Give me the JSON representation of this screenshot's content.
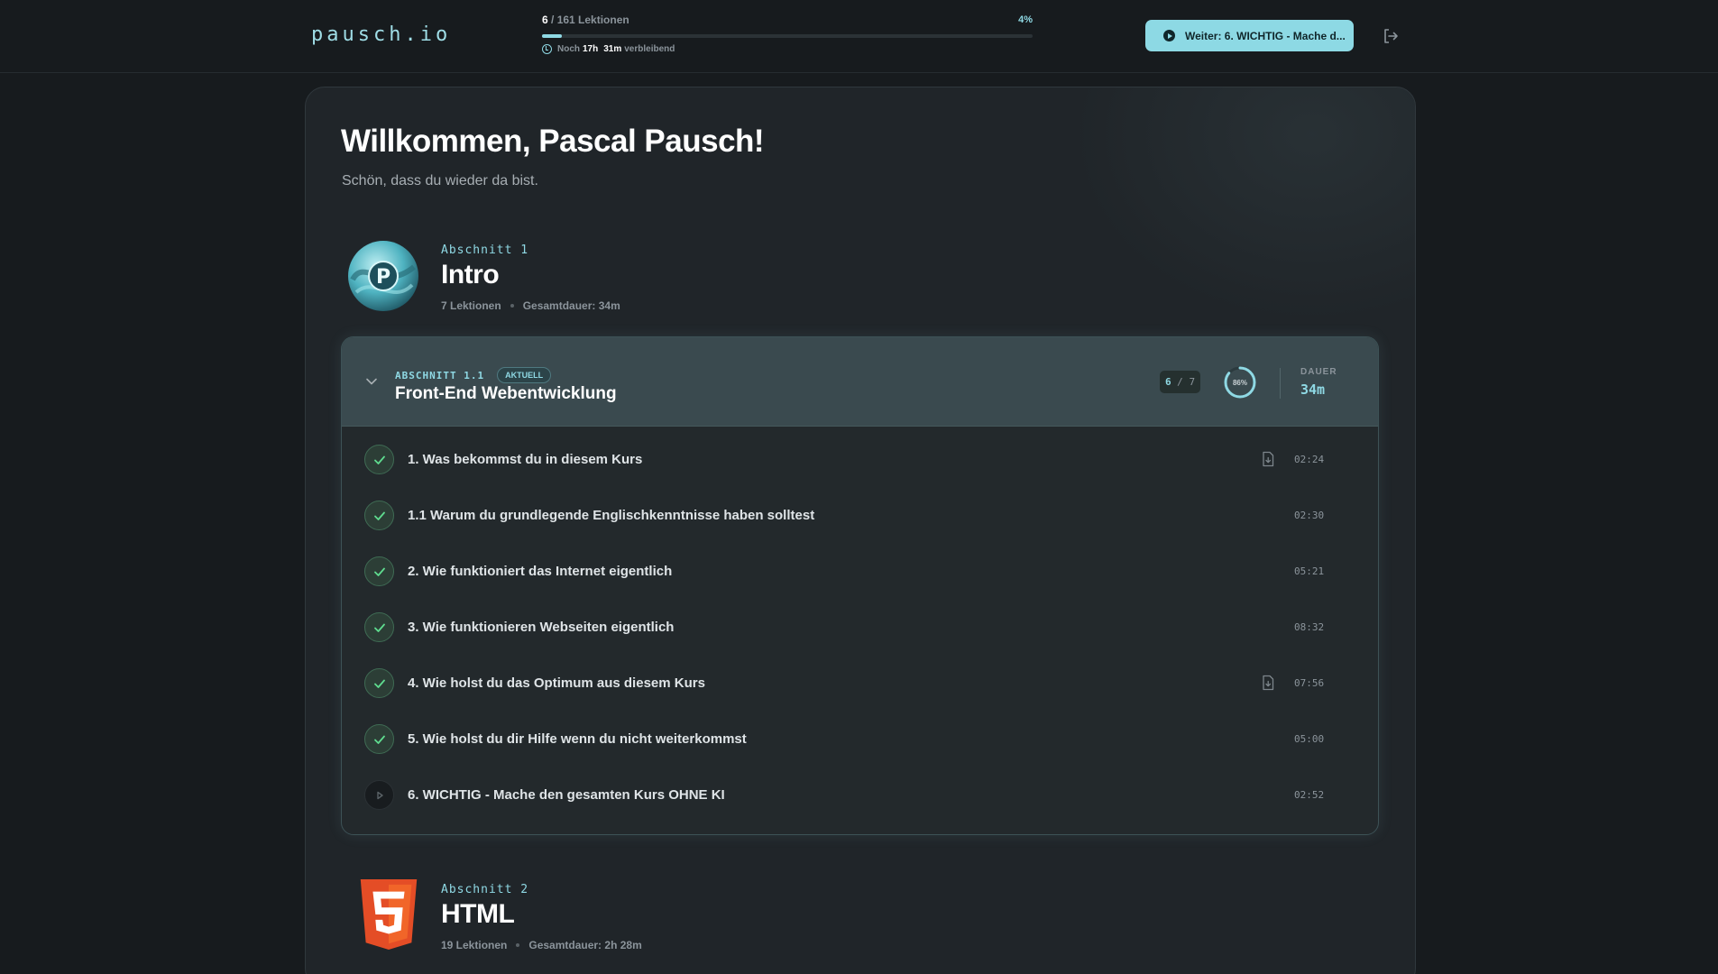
{
  "header": {
    "logo": "pausch.io",
    "progress": {
      "done": "6",
      "total_label": " / 161 Lektionen",
      "percent_label": "4%",
      "fraction": 0.04
    },
    "remaining": {
      "prefix": "Noch",
      "hours": "17h",
      "minutes": "31m",
      "suffix": "verbleibend"
    },
    "continue_label": "Weiter: 6. WICHTIG - Mache d..."
  },
  "welcome": {
    "title": "Willkommen, Pascal Pausch!",
    "subtitle": "Schön, dass du wieder da bist."
  },
  "sections": [
    {
      "kicker": "Abschnitt 1",
      "title": "Intro",
      "lessons_count": "7 Lektionen",
      "total_duration": "Gesamtdauer: 34m",
      "logo_letter": "P",
      "subsection": {
        "kicker": "ABSCHNITT 1.1",
        "badge": "AKTUELL",
        "title": "Front-End Webentwicklung",
        "done": "6",
        "total": "7",
        "percent_label": "86%",
        "percent": 0.86,
        "duration_label": "DAUER",
        "duration": "34m",
        "lessons": [
          {
            "label": "1. Was bekommst du in diesem Kurs",
            "time": "02:24",
            "done": true,
            "has_doc": true
          },
          {
            "label": "1.1 Warum du grundlegende Englischkenntnisse haben solltest",
            "time": "02:30",
            "done": true,
            "has_doc": false
          },
          {
            "label": "2. Wie funktioniert das Internet eigentlich",
            "time": "05:21",
            "done": true,
            "has_doc": false
          },
          {
            "label": "3. Wie funktionieren Webseiten eigentlich",
            "time": "08:32",
            "done": true,
            "has_doc": false
          },
          {
            "label": "4. Wie holst du das Optimum aus diesem Kurs",
            "time": "07:56",
            "done": true,
            "has_doc": true
          },
          {
            "label": "5. Wie holst du dir Hilfe wenn du nicht weiterkommst",
            "time": "05:00",
            "done": true,
            "has_doc": false
          },
          {
            "label": "6. WICHTIG - Mache den gesamten Kurs OHNE KI",
            "time": "02:52",
            "done": false,
            "has_doc": false
          }
        ]
      }
    },
    {
      "kicker": "Abschnitt 2",
      "title": "HTML",
      "lessons_count": "19 Lektionen",
      "total_duration": "Gesamtdauer: 2h 28m",
      "logo_letter": "5"
    }
  ],
  "colors": {
    "accent": "#8fd9e4",
    "background": "#171b1e",
    "card": "#202529",
    "done_green": "#5fdc8f",
    "html_orange": "#e44d26"
  }
}
